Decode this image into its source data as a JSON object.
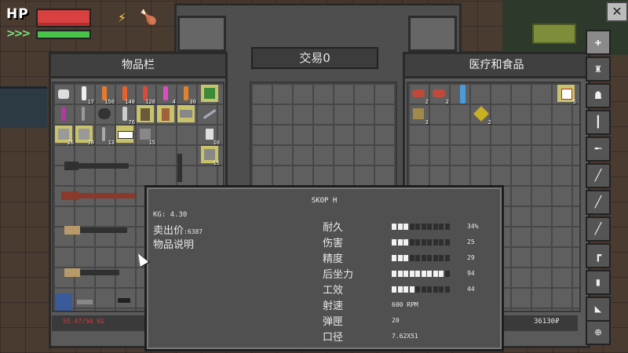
{
  "hud": {
    "hp_label": "HP",
    "stamina_arrows": ">>>",
    "energy_icon": "lightning-icon",
    "food_icon": "drumstick-icon"
  },
  "inventory": {
    "title": "物品栏",
    "weight": "55.47/50 KG",
    "counts": [
      "17",
      "150",
      "140",
      "128",
      "4",
      "30",
      "76",
      "26",
      "30",
      "13",
      "15",
      "10",
      "15"
    ]
  },
  "trade": {
    "title": "交易0"
  },
  "vendor": {
    "title": "医疗和食品",
    "money": "36130₽",
    "counts": [
      "2",
      "2",
      "3",
      "2",
      "5"
    ]
  },
  "tooltip": {
    "item_name": "SKOP H",
    "kg": "KG: 4.30",
    "sell_label": "卖出价",
    "sell_value": ":6387",
    "description_label": "物品说明",
    "stats": [
      {
        "label": "耐久",
        "value": "34%",
        "fraction": 0.34
      },
      {
        "label": "伤害",
        "value": "25",
        "fraction": 0.25
      },
      {
        "label": "精度",
        "value": "29",
        "fraction": 0.29
      },
      {
        "label": "后坐力",
        "value": "94",
        "fraction": 0.94
      },
      {
        "label": "工效",
        "value": "44",
        "fraction": 0.44
      }
    ],
    "specs": [
      {
        "label": "射速",
        "value": "600 RPM"
      },
      {
        "label": "弹匣",
        "value": "20"
      },
      {
        "label": "口径",
        "value": "7.62X51"
      }
    ]
  },
  "sidebar": {
    "icons": [
      "medkit-icon",
      "spray-icon",
      "armor-icon",
      "ammo-icon",
      "rifle-icon",
      "knife-icon",
      "sniper-icon",
      "sniper-icon-2",
      "pistol-icon",
      "magazine-icon",
      "stock-icon",
      "scope-icon"
    ]
  },
  "colors": {
    "hp": "#d94040",
    "stamina": "#48c248",
    "weight_over": "#d63c3c",
    "highlight_slot": "#c8c26a"
  }
}
